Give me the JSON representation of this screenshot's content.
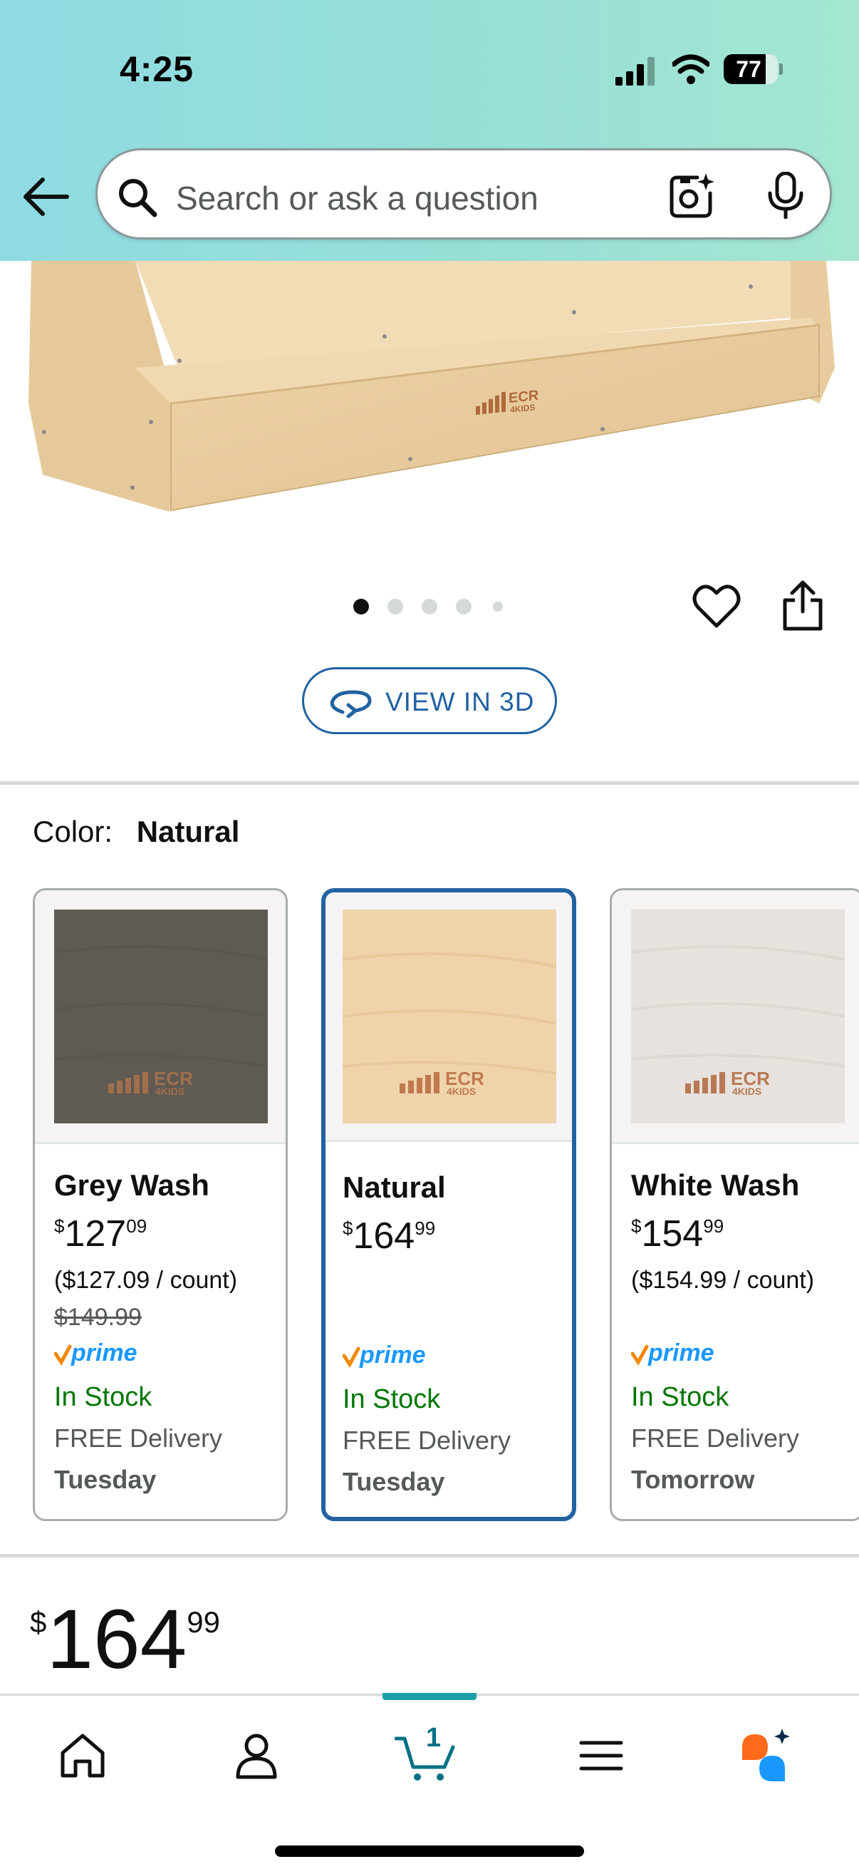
{
  "status_bar": {
    "time": "4:25",
    "battery_level": "77"
  },
  "header": {
    "search_placeholder": "Search or ask a question"
  },
  "product_image": {
    "brand_mark": "ECR 4KIDS"
  },
  "carousel": {
    "total_images": 5,
    "active_index": 0
  },
  "view_3d": {
    "label": "VIEW IN 3D"
  },
  "color_selector": {
    "label": "Color:",
    "selected": "Natural",
    "options": [
      {
        "name": "Grey Wash",
        "price_symbol": "$",
        "price_whole": "127",
        "price_fraction": "09",
        "unit_price": "($127.09 / count)",
        "list_price": "$149.99",
        "stock": "In Stock",
        "delivery": "FREE Delivery",
        "delivery_day": "Tuesday",
        "swatch_color": "#5f5a52",
        "logo_text": "ECR 4KIDS"
      },
      {
        "name": "Natural",
        "price_symbol": "$",
        "price_whole": "164",
        "price_fraction": "99",
        "stock": "In Stock",
        "delivery": "FREE Delivery",
        "delivery_day": "Tuesday",
        "swatch_color": "#efd4ab",
        "logo_text": "ECR 4KIDS"
      },
      {
        "name": "White Wash",
        "price_symbol": "$",
        "price_whole": "154",
        "price_fraction": "99",
        "unit_price": "($154.99 / count)",
        "stock": "In Stock",
        "delivery": "FREE Delivery",
        "delivery_day": "Tomorrow",
        "swatch_color": "#e7e2dd",
        "logo_text": "ECR 4KIDS"
      }
    ]
  },
  "price": {
    "symbol": "$",
    "whole": "164",
    "fraction": "99"
  },
  "bottom_nav": {
    "cart_count": "1",
    "active": "cart"
  },
  "colors": {
    "accent_blue": "#2162a1",
    "stock_green": "#007600",
    "cart_teal": "#1aa0a6",
    "prime_blue": "#1a98ff",
    "prime_check_orange": "#f08804"
  }
}
